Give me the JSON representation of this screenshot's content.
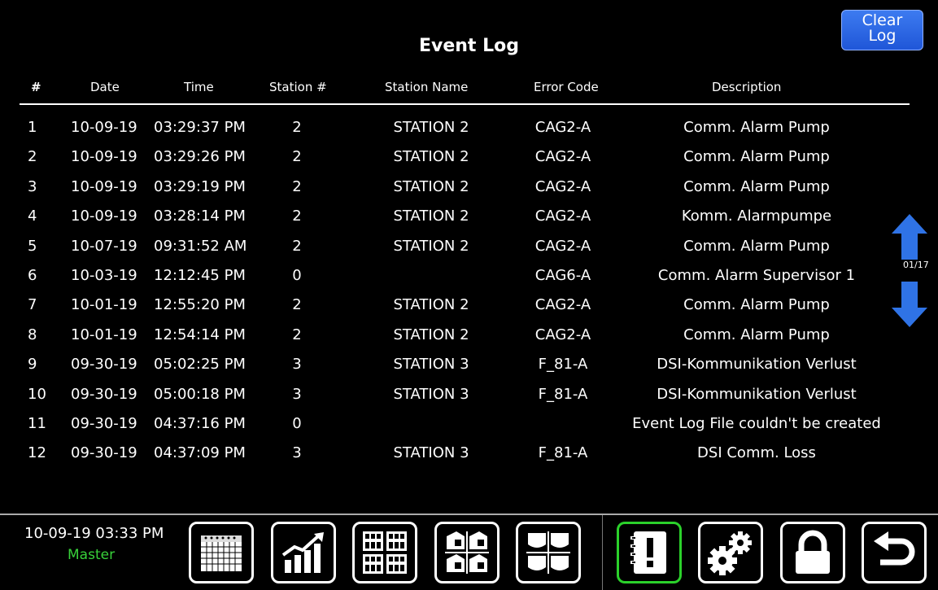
{
  "header": {
    "title": "Event Log",
    "clear_button": [
      "Clear",
      "Log"
    ]
  },
  "columns": [
    "#",
    "Date",
    "Time",
    "Station #",
    "Station Name",
    "Error Code",
    "Description"
  ],
  "rows": [
    {
      "num": "1",
      "date": "10-09-19",
      "time": "03:29:37 PM",
      "station": "2",
      "name": "STATION 2",
      "code": "CAG2-A",
      "desc": "Comm. Alarm Pump"
    },
    {
      "num": "2",
      "date": "10-09-19",
      "time": "03:29:26 PM",
      "station": "2",
      "name": "STATION 2",
      "code": "CAG2-A",
      "desc": "Comm. Alarm Pump"
    },
    {
      "num": "3",
      "date": "10-09-19",
      "time": "03:29:19 PM",
      "station": "2",
      "name": "STATION 2",
      "code": "CAG2-A",
      "desc": "Comm. Alarm Pump"
    },
    {
      "num": "4",
      "date": "10-09-19",
      "time": "03:28:14 PM",
      "station": "2",
      "name": "STATION 2",
      "code": "CAG2-A",
      "desc": "Komm. Alarmpumpe"
    },
    {
      "num": "5",
      "date": "10-07-19",
      "time": "09:31:52 AM",
      "station": "2",
      "name": "STATION 2",
      "code": "CAG2-A",
      "desc": "Comm. Alarm Pump"
    },
    {
      "num": "6",
      "date": "10-03-19",
      "time": "12:12:45 PM",
      "station": "0",
      "name": "",
      "code": "CAG6-A",
      "desc": "Comm. Alarm Supervisor 1"
    },
    {
      "num": "7",
      "date": "10-01-19",
      "time": "12:55:20 PM",
      "station": "2",
      "name": "STATION 2",
      "code": "CAG2-A",
      "desc": "Comm. Alarm Pump"
    },
    {
      "num": "8",
      "date": "10-01-19",
      "time": "12:54:14 PM",
      "station": "2",
      "name": "STATION 2",
      "code": "CAG2-A",
      "desc": "Comm. Alarm Pump"
    },
    {
      "num": "9",
      "date": "09-30-19",
      "time": "05:02:25 PM",
      "station": "3",
      "name": "STATION 3",
      "code": "F_81-A",
      "desc": "DSI-Kommunikation Verlust"
    },
    {
      "num": "10",
      "date": "09-30-19",
      "time": "05:00:18 PM",
      "station": "3",
      "name": "STATION 3",
      "code": "F_81-A",
      "desc": "DSI-Kommunikation Verlust"
    },
    {
      "num": "11",
      "date": "09-30-19",
      "time": "04:37:16 PM",
      "station": "0",
      "name": "",
      "code": "",
      "desc": "Event Log File couldn't be created"
    },
    {
      "num": "12",
      "date": "09-30-19",
      "time": "04:37:09 PM",
      "station": "3",
      "name": "STATION 3",
      "code": "F_81-A",
      "desc": "DSI Comm. Loss"
    }
  ],
  "pager": {
    "indicator": "01/17"
  },
  "footer": {
    "datetime": "10-09-19 03:33 PM",
    "role": "Master"
  },
  "nav": [
    {
      "icon": "calendar-icon",
      "active": false
    },
    {
      "icon": "trend-chart-icon",
      "active": false
    },
    {
      "icon": "keypad-grid-icon",
      "active": false
    },
    {
      "icon": "stations-icon",
      "active": false
    },
    {
      "icon": "tanks-icon",
      "active": false
    },
    {
      "icon": "event-log-icon",
      "active": true
    },
    {
      "icon": "settings-gears-icon",
      "active": false
    },
    {
      "icon": "lock-icon",
      "active": false
    },
    {
      "icon": "back-arrow-icon",
      "active": false
    }
  ],
  "colors": {
    "active_border": "#2bd12b",
    "role_text": "#38d13a",
    "button_blue": "#2f6cf0",
    "scroll_arrow": "#2f73e6"
  }
}
